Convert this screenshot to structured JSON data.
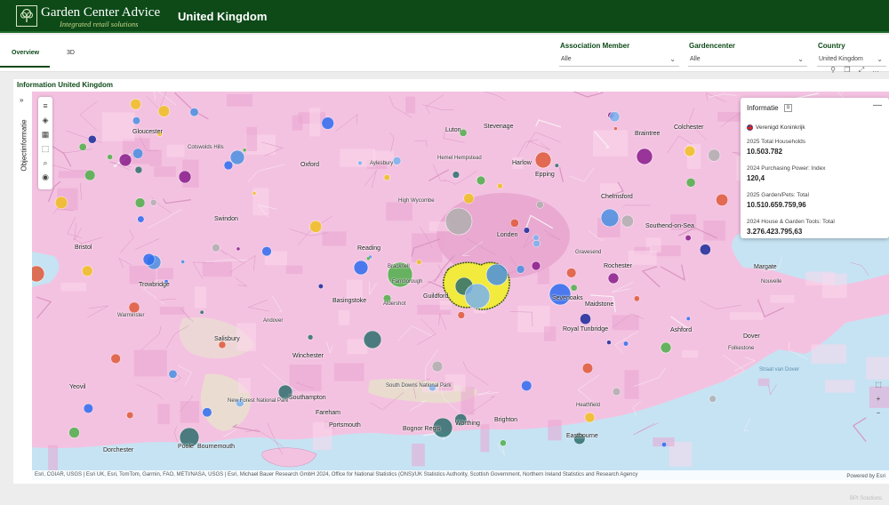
{
  "header": {
    "logo_title": "Garden Center Advice",
    "logo_subtitle": "Integrated retail solutions",
    "page_title": "United Kingdom"
  },
  "tabs": [
    {
      "label": "Overview",
      "active": true
    },
    {
      "label": "3D",
      "active": false
    }
  ],
  "filters": [
    {
      "label": "Association Member",
      "value": "Alle"
    },
    {
      "label": "Gardencenter",
      "value": "Alle"
    },
    {
      "label": "Country",
      "value": "United Kingdom"
    }
  ],
  "panel": {
    "title": "Information United Kingdom",
    "side_label": "Objectinformatie"
  },
  "info_card": {
    "title": "Informatie",
    "country": "Verenigd Koninkrijk",
    "metrics": [
      {
        "label": "2025 Total Households",
        "value": "10.503.782"
      },
      {
        "label": "2024 Purchasing Power: Index",
        "value": "120,4"
      },
      {
        "label": "2025 Garden/Pets: Total",
        "value": "10.510.659.759,96"
      },
      {
        "label": "2024 House & Garden Tools: Total",
        "value": "3.276.423.795,63"
      }
    ]
  },
  "map": {
    "labels": {
      "gloucester": "Gloucester",
      "oxford": "Oxford",
      "luton": "Luton",
      "stevenage": "Stevenage",
      "braintree": "Braintree",
      "colchester": "Colchester",
      "aylesbury": "Aylesbury",
      "hemel": "Hemel Hempstead",
      "harlow": "Harlow",
      "epping": "Epping",
      "swindon": "Swindon",
      "high_wycombe": "High Wycombe",
      "chelmsford": "Chelmsford",
      "southend": "Southend-on-Sea",
      "bristol": "Bristol",
      "reading": "Reading",
      "london": "Londen",
      "grassead": "Gravesend",
      "rochester": "Rochester",
      "margate": "Margate",
      "trowbridge": "Trowbridge",
      "basingstoke": "Basingstoke",
      "farnborough": "Farnborough",
      "bracknell": "Bracknell",
      "guildford": "Guildford",
      "sevenoaks": "Sevenoaks",
      "maidstone": "Maidstone",
      "tunbridge": "Royal Tunbridge",
      "ashford": "Ashford",
      "dover": "Dover",
      "folkestone": "Folkestone",
      "salisbury": "Salisbury",
      "winchester": "Winchester",
      "yeovil": "Yeovil",
      "southampton": "Southampton",
      "fareham": "Fareham",
      "portsmouth": "Portsmouth",
      "bognor": "Bognor Regis",
      "worthing": "Worthing",
      "brighton": "Brighton",
      "eastbourne": "Eastbourne",
      "poole": "Poole",
      "bournemouth": "Bournemouth",
      "dorchester": "Dorchester",
      "new_forest": "New Forest National Park",
      "south_downs": "South Downs National Park",
      "cotswolds": "Cotswolds Hills",
      "strait": "Straat van Dover",
      "warminster": "Warminster",
      "andover": "Andover",
      "aldershot": "Aldershot",
      "heathfield": "Heathfield",
      "nouvelle": "Nouvelle"
    },
    "attribution": "Esri, CGIAR, USGS | Esri UK, Esri, TomTom, Garmin, FAO, METI/NASA, USGS | Esri, Michael Bauer Research GmbH 2024, Office for National Statistics (ONS)/UK Statistics Authority, Scottish Government, Northern Ireland Statistics and Research Agency",
    "powered_by": "Powered by Esri",
    "bubble_colors": [
      "#2e6df0",
      "#4a90e2",
      "#7ab2f0",
      "#e05a3a",
      "#8a1c8c",
      "#4fb04a",
      "#2f6f6f",
      "#f0c020",
      "#b0b0b0",
      "#1a2a9a"
    ]
  },
  "footer": {
    "brand": "BPI Solutions"
  }
}
